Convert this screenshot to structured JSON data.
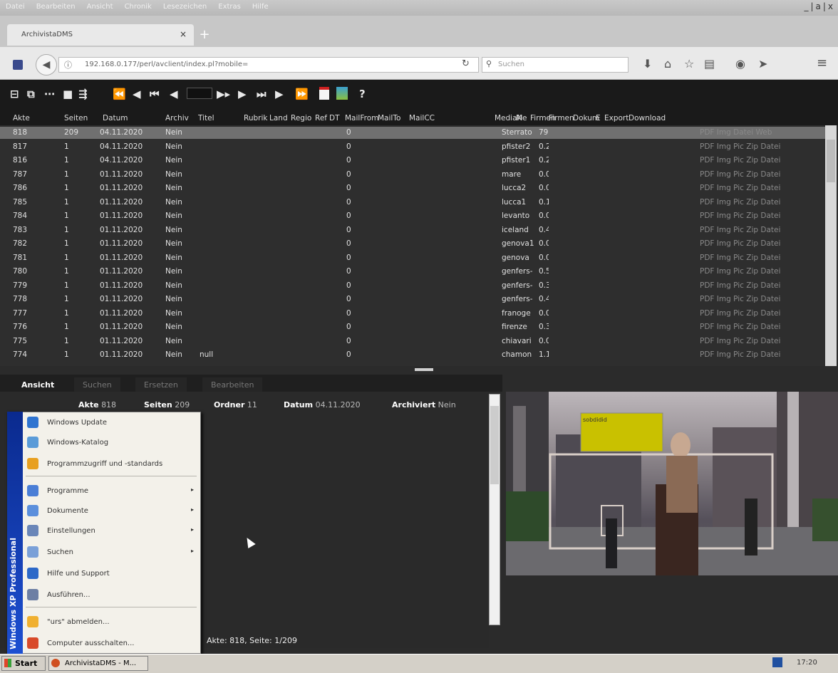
{
  "os_menu": {
    "items": [
      "Datei",
      "Bearbeiten",
      "Ansicht",
      "Chronik",
      "Lesezeichen",
      "Extras",
      "Hilfe"
    ],
    "controls": "_|a|x"
  },
  "browser": {
    "tab_title": "ArchivistaDMS",
    "tab_close": "×",
    "new_tab": "+",
    "url": "192.168.0.177/perl/avclient/index.pl?mobile=",
    "search_placeholder": "Suchen"
  },
  "toolbar": {
    "buttons": [
      "⊟",
      "⧉",
      "⋯",
      "■",
      "⇶",
      "⏪",
      "◀",
      "⏮",
      "◀",
      "▶▸",
      "▶",
      "⏭",
      "▶",
      "⏩"
    ],
    "help": "?"
  },
  "table": {
    "columns": [
      "Akte",
      "Seiten",
      "Datum",
      "Archiv",
      "Titel",
      "Rubrik",
      "Land",
      "Regio",
      "Ref",
      "DT",
      "MailFrom",
      "MailTo",
      "MailCC",
      "MediaN",
      "Me",
      "Firmen",
      "Firmen",
      "Dokum",
      "E",
      "Export",
      "Download"
    ],
    "rows": [
      {
        "akte": "818",
        "seiten": "209",
        "datum": "04.11.2020",
        "archiv": "Nein",
        "titel": "",
        "ref": "0",
        "media": "Sterrato",
        "me": "79",
        "download": "PDF Img Datei Web"
      },
      {
        "akte": "817",
        "seiten": "1",
        "datum": "04.11.2020",
        "archiv": "Nein",
        "titel": "",
        "ref": "0",
        "media": "pfister2",
        "me": "0.2",
        "download": "PDF Img Pic Zip Datei"
      },
      {
        "akte": "816",
        "seiten": "1",
        "datum": "04.11.2020",
        "archiv": "Nein",
        "titel": "",
        "ref": "0",
        "media": "pfister1",
        "me": "0.2",
        "download": "PDF Img Pic Zip Datei"
      },
      {
        "akte": "787",
        "seiten": "1",
        "datum": "01.11.2020",
        "archiv": "Nein",
        "titel": "",
        "ref": "0",
        "media": "mare",
        "me": "0.0",
        "download": "PDF Img Pic Zip Datei"
      },
      {
        "akte": "786",
        "seiten": "1",
        "datum": "01.11.2020",
        "archiv": "Nein",
        "titel": "",
        "ref": "0",
        "media": "lucca2",
        "me": "0.0",
        "download": "PDF Img Pic Zip Datei"
      },
      {
        "akte": "785",
        "seiten": "1",
        "datum": "01.11.2020",
        "archiv": "Nein",
        "titel": "",
        "ref": "0",
        "media": "lucca1",
        "me": "0.1",
        "download": "PDF Img Pic Zip Datei"
      },
      {
        "akte": "784",
        "seiten": "1",
        "datum": "01.11.2020",
        "archiv": "Nein",
        "titel": "",
        "ref": "0",
        "media": "levanto",
        "me": "0.0",
        "download": "PDF Img Pic Zip Datei"
      },
      {
        "akte": "783",
        "seiten": "1",
        "datum": "01.11.2020",
        "archiv": "Nein",
        "titel": "",
        "ref": "0",
        "media": "iceland",
        "me": "0.4",
        "download": "PDF Img Pic Zip Datei"
      },
      {
        "akte": "782",
        "seiten": "1",
        "datum": "01.11.2020",
        "archiv": "Nein",
        "titel": "",
        "ref": "0",
        "media": "genova1",
        "me": "0.0",
        "download": "PDF Img Pic Zip Datei"
      },
      {
        "akte": "781",
        "seiten": "1",
        "datum": "01.11.2020",
        "archiv": "Nein",
        "titel": "",
        "ref": "0",
        "media": "genova",
        "me": "0.0",
        "download": "PDF Img Pic Zip Datei"
      },
      {
        "akte": "780",
        "seiten": "1",
        "datum": "01.11.2020",
        "archiv": "Nein",
        "titel": "",
        "ref": "0",
        "media": "genfers-",
        "me": "0.5",
        "download": "PDF Img Pic Zip Datei"
      },
      {
        "akte": "779",
        "seiten": "1",
        "datum": "01.11.2020",
        "archiv": "Nein",
        "titel": "",
        "ref": "0",
        "media": "genfers-",
        "me": "0.3",
        "download": "PDF Img Pic Zip Datei"
      },
      {
        "akte": "778",
        "seiten": "1",
        "datum": "01.11.2020",
        "archiv": "Nein",
        "titel": "",
        "ref": "0",
        "media": "genfers-",
        "me": "0.4",
        "download": "PDF Img Pic Zip Datei"
      },
      {
        "akte": "777",
        "seiten": "1",
        "datum": "01.11.2020",
        "archiv": "Nein",
        "titel": "",
        "ref": "0",
        "media": "franoge",
        "me": "0.0",
        "download": "PDF Img Pic Zip Datei"
      },
      {
        "akte": "776",
        "seiten": "1",
        "datum": "01.11.2020",
        "archiv": "Nein",
        "titel": "",
        "ref": "0",
        "media": "firenze",
        "me": "0.3",
        "download": "PDF Img Pic Zip Datei"
      },
      {
        "akte": "775",
        "seiten": "1",
        "datum": "01.11.2020",
        "archiv": "Nein",
        "titel": "",
        "ref": "0",
        "media": "chiavari",
        "me": "0.0",
        "download": "PDF Img Pic Zip Datei"
      },
      {
        "akte": "774",
        "seiten": "1",
        "datum": "01.11.2020",
        "archiv": "Nein",
        "titel": "null",
        "ref": "0",
        "media": "chamon",
        "me": "1.1",
        "download": "PDF Img Pic Zip Datei"
      }
    ]
  },
  "tabs": [
    "Ansicht",
    "Suchen",
    "Ersetzen",
    "Bearbeiten"
  ],
  "detail": {
    "akte_label": "Akte",
    "akte": "818",
    "seiten_label": "Seiten",
    "seiten": "209",
    "ordner_label": "Ordner",
    "ordner": "11",
    "datum_label": "Datum",
    "datum": "04.11.2020",
    "archiviert_label": "Archiviert",
    "archiviert": "Nein",
    "status": "Akte: 818, Seite: 1/209"
  },
  "photo": {
    "label": "sobdidid"
  },
  "start_menu": {
    "band": "Windows XP Professional",
    "items": [
      {
        "label": "Windows Update",
        "color": "#2f74d0",
        "arrow": ""
      },
      {
        "label": "Windows-Katalog",
        "color": "#5a9bd8",
        "arrow": ""
      },
      {
        "label": "Programmzugriff und -standards",
        "color": "#e8a020",
        "arrow": ""
      },
      {
        "label": "Programme",
        "color": "#4a7ed6",
        "arrow": "▸"
      },
      {
        "label": "Dokumente",
        "color": "#5b8fdc",
        "arrow": "▸"
      },
      {
        "label": "Einstellungen",
        "color": "#6a86b8",
        "arrow": "▸"
      },
      {
        "label": "Suchen",
        "color": "#7aa0d8",
        "arrow": "▸"
      },
      {
        "label": "Hilfe und Support",
        "color": "#2c68c8",
        "arrow": ""
      },
      {
        "label": "Ausführen...",
        "color": "#6d7fa4",
        "arrow": ""
      },
      {
        "label": "\"urs\" abmelden...",
        "color": "#f0b030",
        "arrow": ""
      },
      {
        "label": "Computer ausschalten...",
        "color": "#d84a2a",
        "arrow": ""
      }
    ]
  },
  "taskbar": {
    "start": "Start",
    "item": "ArchivistaDMS - M...",
    "clock": "17:20"
  }
}
